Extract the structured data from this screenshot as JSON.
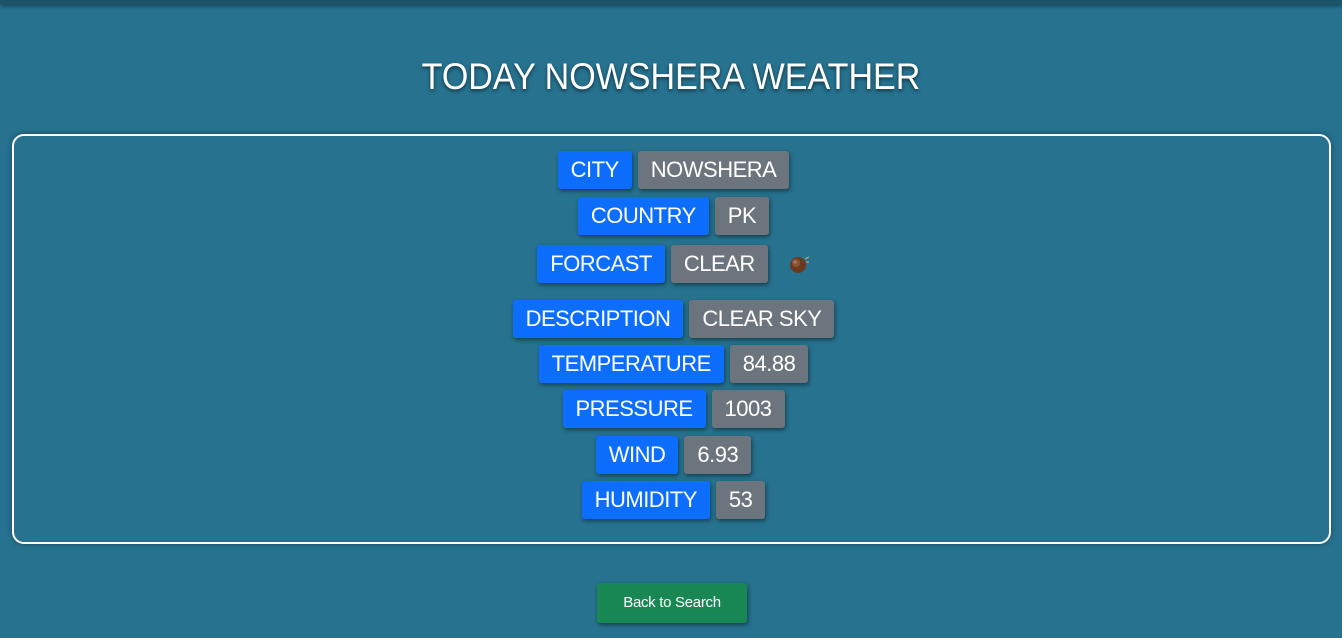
{
  "page": {
    "title": "TODAY NOWSHERA WEATHER"
  },
  "weather": {
    "city": {
      "label": "CITY",
      "value": "NOWSHERA"
    },
    "country": {
      "label": "COUNTRY",
      "value": "PK"
    },
    "forecast": {
      "label": "FORCAST",
      "value": "CLEAR",
      "icon": "weather-clear-icon"
    },
    "description": {
      "label": "DESCRIPTION",
      "value": "CLEAR SKY"
    },
    "temperature": {
      "label": "TEMPERATURE",
      "value": "84.88"
    },
    "pressure": {
      "label": "PRESSURE",
      "value": "1003"
    },
    "wind": {
      "label": "WIND",
      "value": "6.93"
    },
    "humidity": {
      "label": "HUMIDITY",
      "value": "53"
    }
  },
  "actions": {
    "back_label": "Back to Search"
  },
  "colors": {
    "background": "#26728f",
    "key_badge": "#0d6efd",
    "value_badge": "#6c757d",
    "back_button": "#198754",
    "card_border": "#ffffff"
  }
}
